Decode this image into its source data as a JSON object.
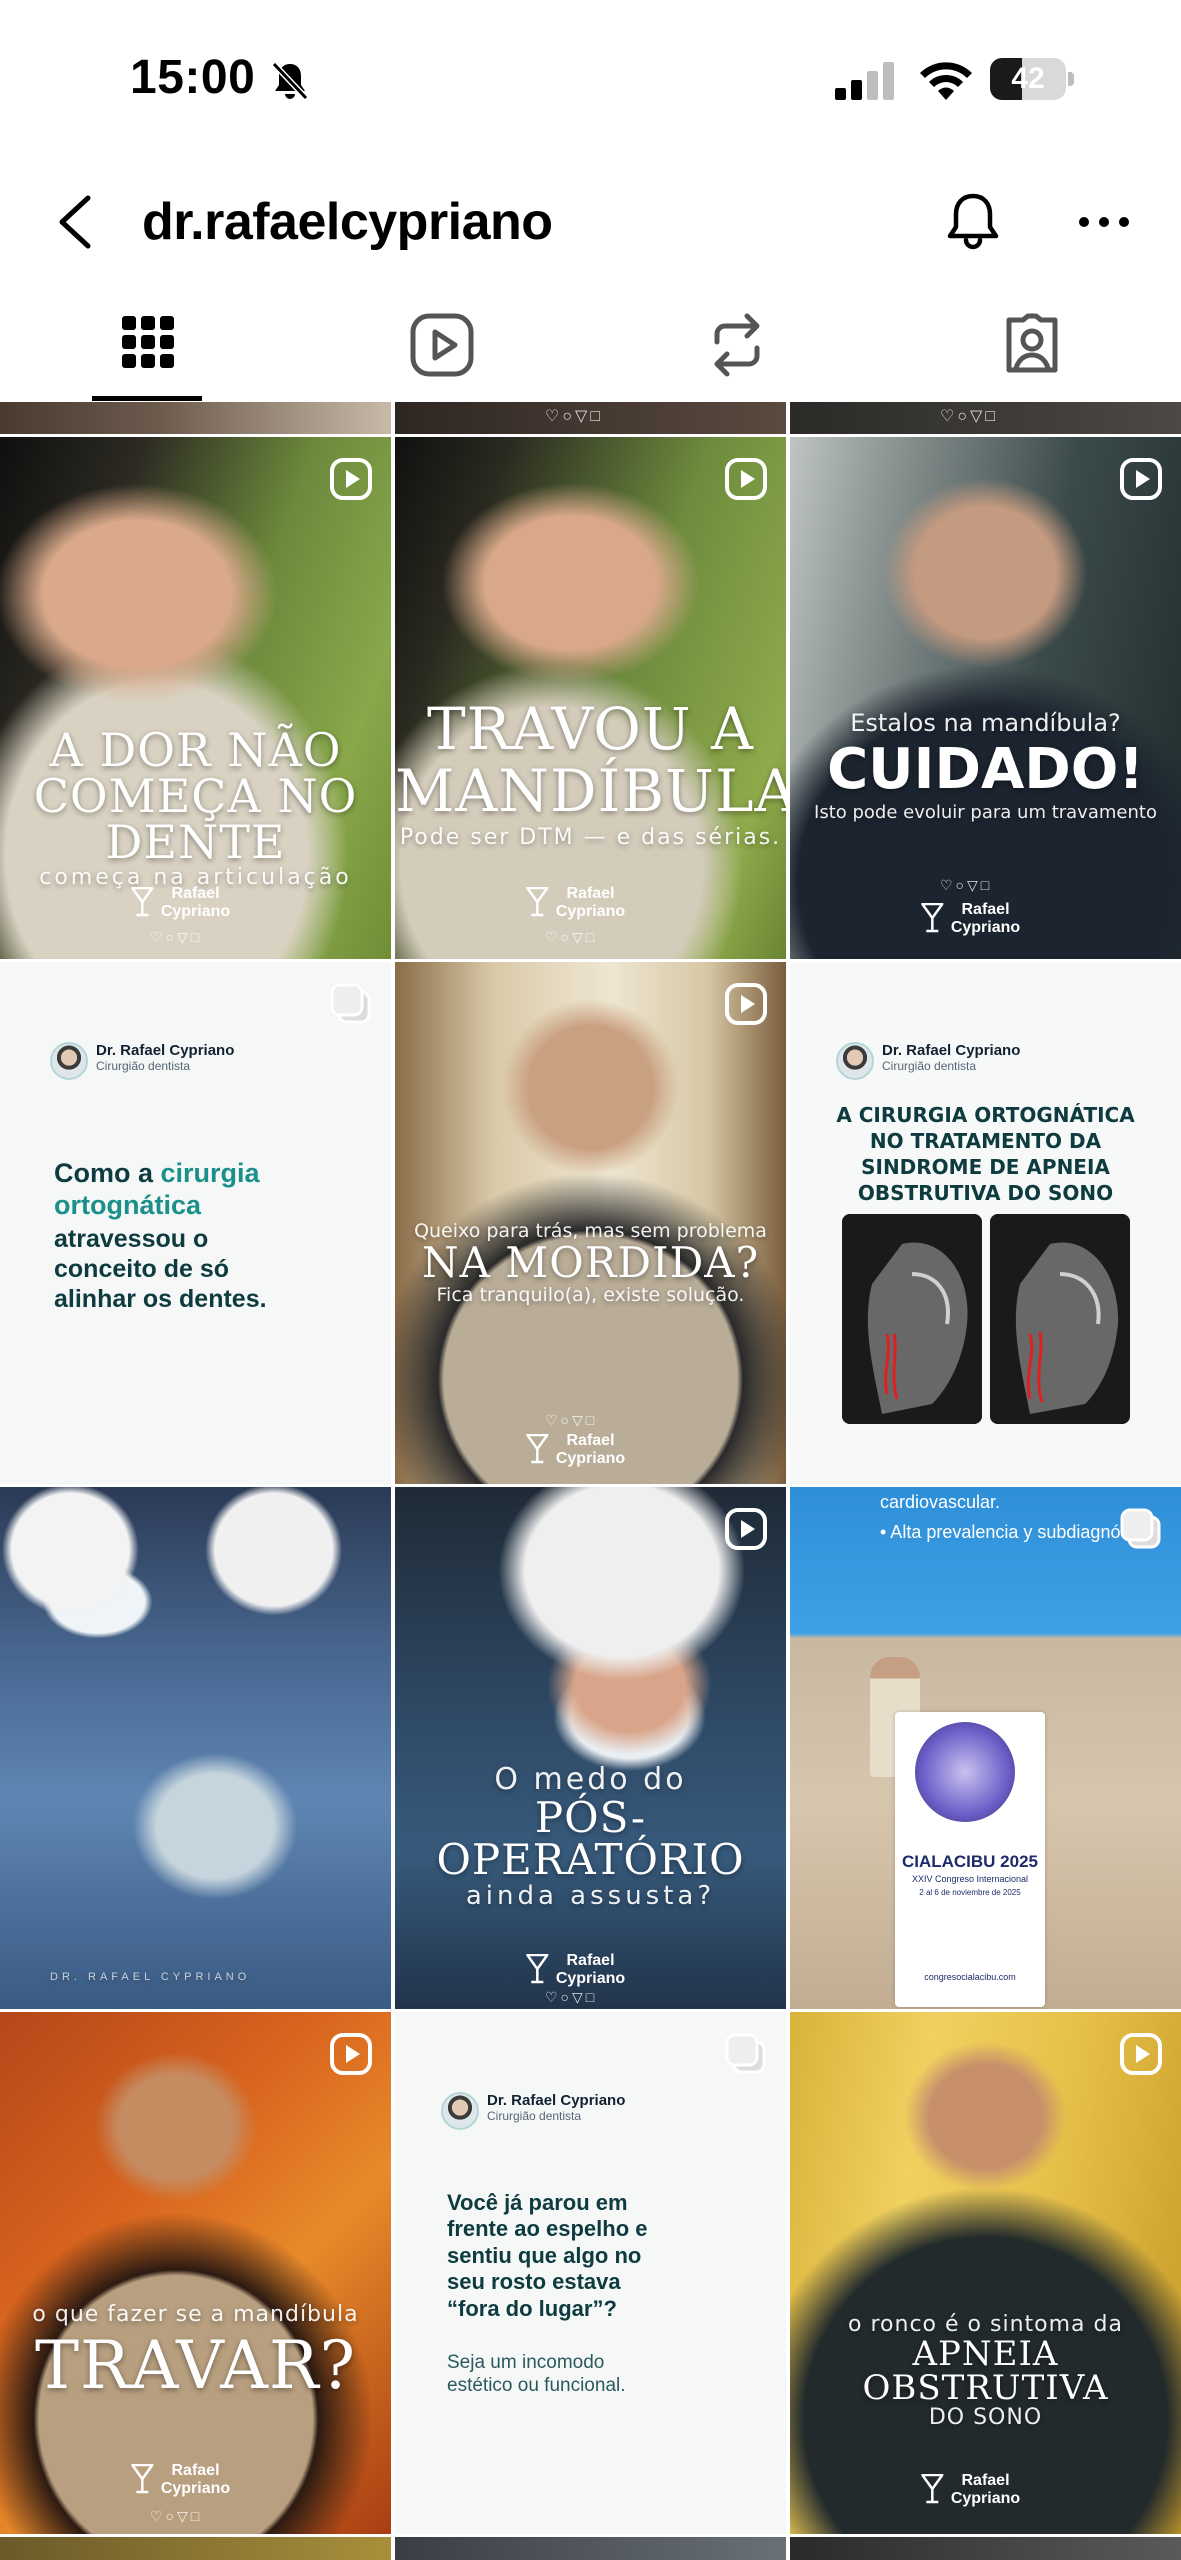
{
  "status_bar": {
    "time": "15:00",
    "battery": "42",
    "battery_level": 0.42
  },
  "header": {
    "username": "dr.rafaelcypriano"
  },
  "tabs": [
    {
      "icon": "grid-icon",
      "active": true
    },
    {
      "icon": "reels-icon",
      "active": false
    },
    {
      "icon": "reposts-icon",
      "active": false
    },
    {
      "icon": "tagged-icon",
      "active": false
    }
  ],
  "posts": {
    "p1": {
      "line1": "A DOR NÃO",
      "line2": "COMEÇA NO DENTE",
      "line3": "começa na articulação",
      "brand": "Rafael",
      "brand2": "Cypriano"
    },
    "p2": {
      "line1": "TRAVOU A",
      "line2": "MANDÍBULA?",
      "line3": "Pode ser DTM — e das sérias.",
      "brand": "Rafael",
      "brand2": "Cypriano"
    },
    "p3": {
      "line1": "Estalos na mandíbula?",
      "line2": "CUIDADO!",
      "line3": "Isto pode evoluir para um travamento",
      "brand": "Rafael",
      "brand2": "Cypriano"
    },
    "p4": {
      "doctor": "Dr. Rafael Cypriano",
      "role": "Cirurgião dentista",
      "title_pre": "Como a ",
      "title_accent1": "cirurgia",
      "title_accent2": "ortognática",
      "title_rest1": "atravessou o",
      "title_rest2": "conceito de só",
      "title_rest3": "alinhar os dentes."
    },
    "p5": {
      "line1": "Queixo para trás, mas sem problema",
      "line2": "NA MORDIDA?",
      "line3": "Fica tranquilo(a), existe solução.",
      "brand": "Rafael",
      "brand2": "Cypriano"
    },
    "p6": {
      "doctor": "Dr. Rafael Cypriano",
      "role": "Cirurgião dentista",
      "title1": "A CIRURGIA ORTOGNÁTICA",
      "title2": "NO TRATAMENTO DA",
      "title3": "SINDROME DE APNEIA",
      "title4": "OBSTRUTIVA DO SONO"
    },
    "p7": {
      "watermark": "DR. RAFAEL CYPRIANO"
    },
    "p8": {
      "line1": "O medo do",
      "line2": "PÓS-OPERATÓRIO",
      "line3": "ainda assusta?",
      "brand": "Rafael",
      "brand2": "Cypriano"
    },
    "p9": {
      "slide1": "cardiovascular.",
      "slide2": "• Alta prevalencia y subdiagnós",
      "banner1": "CIALACIBU 2025",
      "banner2": "XXIV Congreso Internacional",
      "banner3": "2 al 6 de noviembre de 2025",
      "banner4": "congresocialacibu.com"
    },
    "p10": {
      "line1": "o que fazer se a mandíbula",
      "line2": "TRAVAR?",
      "brand": "Rafael",
      "brand2": "Cypriano"
    },
    "p11": {
      "doctor": "Dr. Rafael Cypriano",
      "role": "Cirurgião dentista",
      "q1": "Você já parou em",
      "q2": "frente ao espelho e",
      "q3": "sentiu que algo no",
      "q4": "seu rosto estava",
      "q5": "“fora do lugar”?",
      "s1": "Seja um incomodo",
      "s2": "estético ou funcional."
    },
    "p12": {
      "line1": "o ronco é o sintoma da",
      "line2": "APNEIA OBSTRUTIVA",
      "line3": "DO SONO",
      "brand": "Rafael",
      "brand2": "Cypriano"
    }
  }
}
